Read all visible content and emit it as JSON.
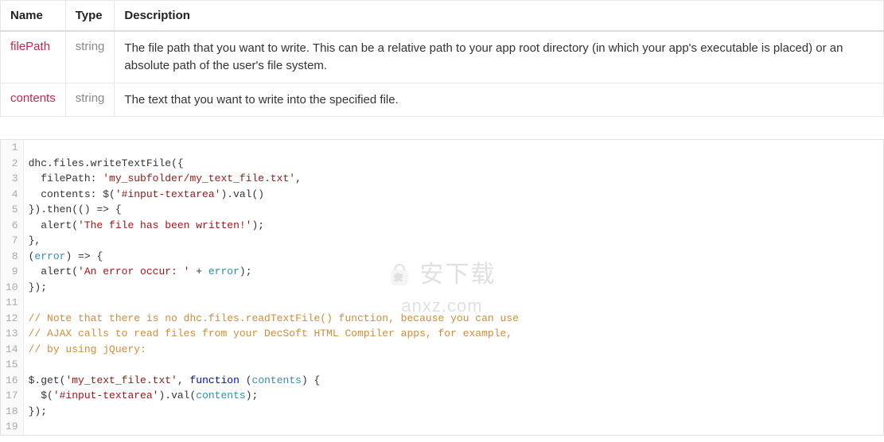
{
  "table": {
    "headers": [
      "Name",
      "Type",
      "Description"
    ],
    "rows": [
      {
        "name": "filePath",
        "type": "string",
        "description": "The file path that you want to write. This can be a relative path to your app root directory (in which your app's executable is placed) or an absolute path of the user's file system."
      },
      {
        "name": "contents",
        "type": "string",
        "description": "The text that you want to write into the specified file."
      }
    ]
  },
  "code": {
    "lines": [
      {
        "n": 1,
        "tokens": []
      },
      {
        "n": 2,
        "tokens": [
          {
            "t": "dhc",
            "c": "tok-obj"
          },
          {
            "t": ".",
            "c": "tok-op"
          },
          {
            "t": "files",
            "c": "tok-obj"
          },
          {
            "t": ".",
            "c": "tok-op"
          },
          {
            "t": "writeTextFile",
            "c": "tok-fn"
          },
          {
            "t": "({",
            "c": "tok-op"
          }
        ]
      },
      {
        "n": 3,
        "tokens": [
          {
            "t": "  filePath: ",
            "c": "tok-prop"
          },
          {
            "t": "'my_subfolder/my_text_file.txt'",
            "c": "tok-str"
          },
          {
            "t": ",",
            "c": "tok-op"
          }
        ]
      },
      {
        "n": 4,
        "tokens": [
          {
            "t": "  contents: ",
            "c": "tok-prop"
          },
          {
            "t": "$(",
            "c": "tok-fn"
          },
          {
            "t": "'#input-textarea'",
            "c": "tok-str"
          },
          {
            "t": ").",
            "c": "tok-op"
          },
          {
            "t": "val",
            "c": "tok-fn"
          },
          {
            "t": "()",
            "c": "tok-op"
          }
        ]
      },
      {
        "n": 5,
        "tokens": [
          {
            "t": "}).",
            "c": "tok-op"
          },
          {
            "t": "then",
            "c": "tok-fn"
          },
          {
            "t": "(() => {",
            "c": "tok-op"
          }
        ]
      },
      {
        "n": 6,
        "tokens": [
          {
            "t": "  alert",
            "c": "tok-fn"
          },
          {
            "t": "(",
            "c": "tok-op"
          },
          {
            "t": "'The file has been written!'",
            "c": "tok-str"
          },
          {
            "t": ");",
            "c": "tok-op"
          }
        ]
      },
      {
        "n": 7,
        "tokens": [
          {
            "t": "},",
            "c": "tok-op"
          }
        ]
      },
      {
        "n": 8,
        "tokens": [
          {
            "t": "(",
            "c": "tok-op"
          },
          {
            "t": "error",
            "c": "tok-var"
          },
          {
            "t": ") => {",
            "c": "tok-op"
          }
        ]
      },
      {
        "n": 9,
        "tokens": [
          {
            "t": "  alert",
            "c": "tok-fn"
          },
          {
            "t": "(",
            "c": "tok-op"
          },
          {
            "t": "'An error occur: '",
            "c": "tok-str"
          },
          {
            "t": " + ",
            "c": "tok-op"
          },
          {
            "t": "error",
            "c": "tok-var"
          },
          {
            "t": ");",
            "c": "tok-op"
          }
        ]
      },
      {
        "n": 10,
        "tokens": [
          {
            "t": "});",
            "c": "tok-op"
          }
        ]
      },
      {
        "n": 11,
        "tokens": []
      },
      {
        "n": 12,
        "tokens": [
          {
            "t": "// Note that there is no dhc.files.readTextFile() function, because you can use",
            "c": "tok-cmt"
          }
        ]
      },
      {
        "n": 13,
        "tokens": [
          {
            "t": "// AJAX calls to read files from your DecSoft HTML Compiler apps, for example,",
            "c": "tok-cmt"
          }
        ]
      },
      {
        "n": 14,
        "tokens": [
          {
            "t": "// by using jQuery:",
            "c": "tok-cmt"
          }
        ]
      },
      {
        "n": 15,
        "tokens": []
      },
      {
        "n": 16,
        "tokens": [
          {
            "t": "$.",
            "c": "tok-obj"
          },
          {
            "t": "get",
            "c": "tok-fn"
          },
          {
            "t": "(",
            "c": "tok-op"
          },
          {
            "t": "'my_text_file.txt'",
            "c": "tok-str"
          },
          {
            "t": ", ",
            "c": "tok-op"
          },
          {
            "t": "function",
            "c": "tok-kw"
          },
          {
            "t": " (",
            "c": "tok-op"
          },
          {
            "t": "contents",
            "c": "tok-var"
          },
          {
            "t": ") {",
            "c": "tok-op"
          }
        ]
      },
      {
        "n": 17,
        "tokens": [
          {
            "t": "  $(",
            "c": "tok-fn"
          },
          {
            "t": "'#input-textarea'",
            "c": "tok-str"
          },
          {
            "t": ").",
            "c": "tok-op"
          },
          {
            "t": "val",
            "c": "tok-fn"
          },
          {
            "t": "(",
            "c": "tok-op"
          },
          {
            "t": "contents",
            "c": "tok-var"
          },
          {
            "t": ");",
            "c": "tok-op"
          }
        ]
      },
      {
        "n": 18,
        "tokens": [
          {
            "t": "});",
            "c": "tok-op"
          }
        ]
      },
      {
        "n": 19,
        "tokens": []
      }
    ]
  },
  "watermark": {
    "top": "安下载",
    "bottom": "anxz.com"
  }
}
